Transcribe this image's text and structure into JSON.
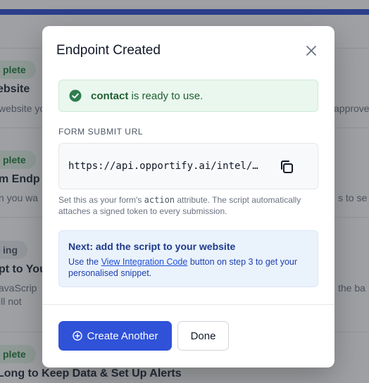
{
  "background": {
    "sections": [
      {
        "badge": "plete",
        "title": "ebsite",
        "text_left": "website yo",
        "text_right": "approve"
      },
      {
        "badge": "plete",
        "title": "m Endp",
        "text_left": "n you wa",
        "text_right": "s to se"
      },
      {
        "badge": "ing",
        "title": "pt to You",
        "text_left": "avaScrip",
        "text_left2": "ill not",
        "text_right": "the ba"
      },
      {
        "badge": "plete",
        "title": "Long to Keep Data & Set Up Alerts"
      }
    ]
  },
  "modal": {
    "title": "Endpoint Created",
    "close_icon": "close-icon",
    "success": {
      "icon": "check-circle-icon",
      "endpoint_name": "contact",
      "message": " is ready to use."
    },
    "form_submit_url": {
      "label": "FORM SUBMIT URL",
      "value": "https://api.opportify.ai/intel/…",
      "copy_icon": "copy-icon",
      "helper_pre": "Set this as your form's ",
      "helper_code": "action",
      "helper_post": " attribute. The script automatically attaches a signed token to every submission."
    },
    "next_step": {
      "title": "Next: add the script to your website",
      "text_pre": "Use the ",
      "link_label": "View Integration Code",
      "text_post": " button on step 3 to get your personalised snippet."
    },
    "buttons": {
      "create_another": "Create Another",
      "done": "Done"
    }
  },
  "colors": {
    "primary": "#2f52d8",
    "success_bg": "#eaf7ee",
    "success_icon": "#2e7d4f",
    "info_bg": "#eaf2fc"
  }
}
